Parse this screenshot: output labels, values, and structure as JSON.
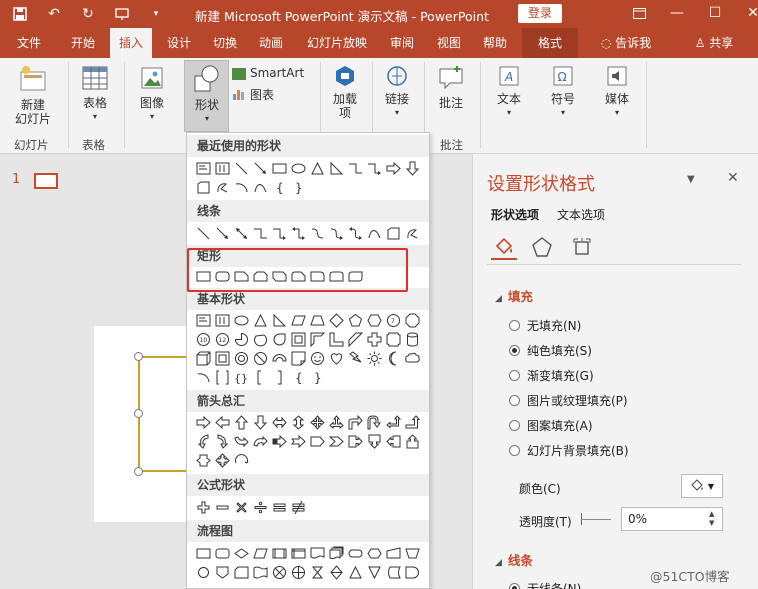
{
  "titlebar": {
    "title": "新建 Microsoft PowerPoint 演示文稿 - PowerPoint",
    "login": "登录"
  },
  "tabs": [
    "文件",
    "开始",
    "插入",
    "设计",
    "切换",
    "动画",
    "幻灯片放映",
    "审阅",
    "视图",
    "帮助",
    "格式",
    "告诉我",
    "共享"
  ],
  "ribbon": {
    "new_slide": "新建\n幻灯片",
    "table": "表格",
    "image": "图像",
    "shapes": "形状",
    "smartart": "SmartArt",
    "chart": "图表",
    "addins": "加载\n项",
    "link": "链接",
    "comment": "批注",
    "text": "文本",
    "symbol": "符号",
    "media": "媒体",
    "groups": {
      "slides": "幻灯片",
      "tables": "表格",
      "comments": "批注"
    }
  },
  "slides_panel": {
    "slide_number": "1"
  },
  "shapes_menu": {
    "recent": "最近使用的形状",
    "lines": "线条",
    "rectangles": "矩形",
    "basic": "基本形状",
    "arrows": "箭头总汇",
    "equation": "公式形状",
    "flowchart": "流程图"
  },
  "format_pane": {
    "title": "设置形状格式",
    "tab_shape": "形状选项",
    "tab_text": "文本选项",
    "fill_section": "填充",
    "fill_options": [
      {
        "label": "无填充(N)",
        "selected": false
      },
      {
        "label": "纯色填充(S)",
        "selected": true
      },
      {
        "label": "渐变填充(G)",
        "selected": false
      },
      {
        "label": "图片或纹理填充(P)",
        "selected": false
      },
      {
        "label": "图案填充(A)",
        "selected": false
      },
      {
        "label": "幻灯片背景填充(B)",
        "selected": false
      }
    ],
    "color_label": "颜色(C)",
    "transparency_label": "透明度(T)",
    "transparency_value": "0%",
    "line_section": "线条",
    "line_option": "无线条(N)"
  },
  "watermark": "@51CTO博客",
  "colors": {
    "accent": "#b7472a",
    "highlight": "#e0302a"
  }
}
